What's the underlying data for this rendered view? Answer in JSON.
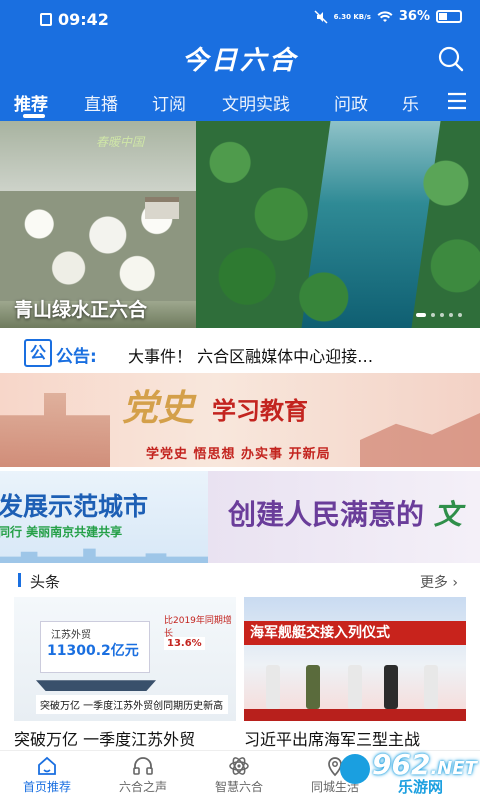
{
  "status_bar": {
    "time": "09:42",
    "speed": "6.30 KB/s",
    "battery": "36%"
  },
  "header": {
    "title": "今日六合"
  },
  "tabs": [
    {
      "label": "推荐"
    },
    {
      "label": "直播"
    },
    {
      "label": "订阅"
    },
    {
      "label": "文明实践"
    },
    {
      "label": "问政"
    },
    {
      "label": "乐"
    }
  ],
  "hero": {
    "caption": "青山绿水正六合",
    "stamp": "春暖中国"
  },
  "notice": {
    "label": "公告:",
    "icon_text": "公",
    "text": "大事件！ 六合区融媒体中心迎接…"
  },
  "banner1": {
    "title": "党史",
    "title2": "学习教育",
    "subtitle": "学党史 悟思想 办实事 开新局"
  },
  "banner2": {
    "left_title": "发展示范城市",
    "left_sub": "同行   美丽南京共建共享",
    "right_title_a": "创建人民满意的",
    "right_title_b": "文"
  },
  "section": {
    "title": "头条",
    "more": "更多 ›"
  },
  "cards": [
    {
      "panel_title": "江苏外贸",
      "panel_value": "11300.2亿元",
      "badge1": "比2019年同期增长",
      "badge2": "13.6%",
      "caption": "突破万亿  一季度江苏外贸创同期历史新高",
      "headline": "突破万亿 一季度江苏外贸"
    },
    {
      "banner": "海军舰艇交接入列仪式",
      "headline": "习近平出席海军三型主战"
    }
  ],
  "bottom_nav": [
    {
      "label": "首页推荐",
      "icon": "home-icon"
    },
    {
      "label": "六合之声",
      "icon": "headphones-icon"
    },
    {
      "label": "智慧六合",
      "icon": "atom-icon"
    },
    {
      "label": "同城生活",
      "icon": "location-icon"
    }
  ],
  "watermark": {
    "num": "962",
    "domain": ".NET",
    "text": "乐游网"
  },
  "colors": {
    "brand_blue": "#1a6fe0",
    "red": "#c3241f"
  }
}
